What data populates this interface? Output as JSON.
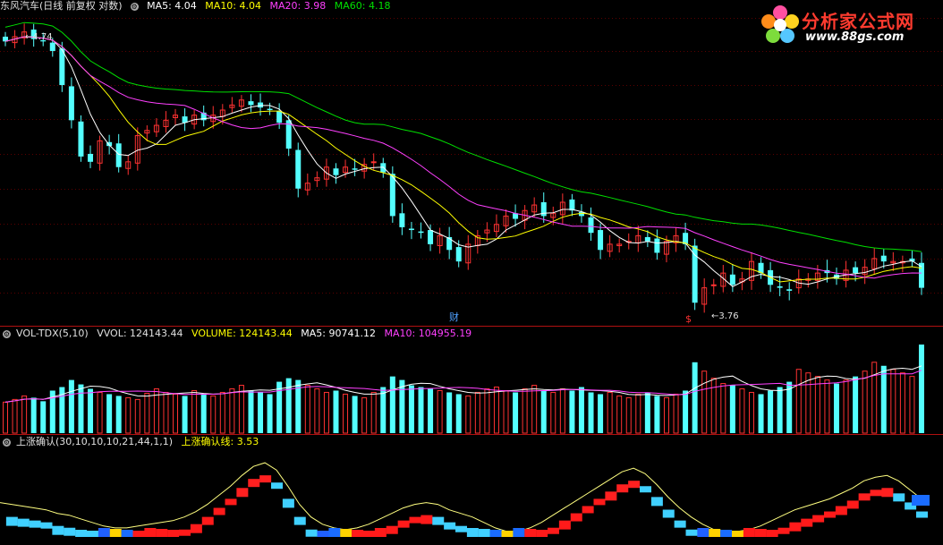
{
  "header": {
    "title": "东风汽车(日线 前复权 对数)",
    "ma5": "MA5: 4.04",
    "ma10": "MA10: 4.04",
    "ma20": "MA20: 3.98",
    "ma60": "MA60: 4.18"
  },
  "logo": {
    "name": "分析家公式网",
    "url": "www.88gs.com"
  },
  "annotations": {
    "high_label": "4.74",
    "low_label": "3.76",
    "cai1": "财",
    "cai2": "$"
  },
  "vol_header": {
    "name": "VOL-TDX(5,10)",
    "vvol": "VVOL: 124143.44",
    "volume": "VOLUME: 124143.44",
    "ma5": "MA5: 90741.12",
    "ma10": "MA10: 104955.19"
  },
  "ind_header": {
    "name": "上涨确认(30,10,10,10,21,44,1,1)",
    "line": "上涨确认线: 3.53"
  },
  "colors": {
    "up": "#ff3232",
    "down": "#54ffff",
    "ma5": "#ffffff",
    "ma10": "#ffff00",
    "ma20": "#ff40ff",
    "ma60": "#00e000"
  },
  "chart_data": [
    {
      "type": "candlestick",
      "title": "东风汽车(日线 前复权 对数)",
      "ylim": [
        3.7,
        4.8
      ],
      "close": [
        4.7,
        4.72,
        4.74,
        4.71,
        4.7,
        4.66,
        4.52,
        4.38,
        4.24,
        4.22,
        4.3,
        4.28,
        4.2,
        4.22,
        4.32,
        4.34,
        4.36,
        4.38,
        4.4,
        4.37,
        4.4,
        4.38,
        4.4,
        4.42,
        4.44,
        4.46,
        4.44,
        4.43,
        4.42,
        4.37,
        4.27,
        4.12,
        4.14,
        4.16,
        4.2,
        4.17,
        4.2,
        4.19,
        4.21,
        4.22,
        4.18,
        4.02,
        3.98,
        3.97,
        3.96,
        3.92,
        3.95,
        3.9,
        3.86,
        3.92,
        3.95,
        3.97,
        3.99,
        4.02,
        4.01,
        4.04,
        4.06,
        4.02,
        4.03,
        4.07,
        4.04,
        4.02,
        3.96,
        3.9,
        3.92,
        3.92,
        3.93,
        3.95,
        3.93,
        3.89,
        3.93,
        3.95,
        3.92,
        3.72,
        3.77,
        3.78,
        3.82,
        3.78,
        3.8,
        3.86,
        3.82,
        3.78,
        3.77,
        3.76,
        3.8,
        3.8,
        3.82,
        3.82,
        3.8,
        3.83,
        3.82,
        3.84,
        3.87,
        3.86,
        3.86,
        3.86,
        3.86,
        3.77
      ]
    },
    {
      "type": "bar",
      "title": "VOL-TDX(5,10)",
      "values": [
        35,
        38,
        42,
        40,
        36,
        48,
        52,
        60,
        55,
        50,
        46,
        44,
        42,
        40,
        38,
        45,
        50,
        46,
        44,
        42,
        48,
        44,
        42,
        46,
        50,
        54,
        48,
        46,
        44,
        58,
        62,
        60,
        54,
        50,
        46,
        48,
        44,
        42,
        40,
        46,
        52,
        64,
        60,
        54,
        52,
        50,
        48,
        46,
        44,
        42,
        46,
        50,
        52,
        48,
        46,
        50,
        54,
        48,
        46,
        50,
        48,
        52,
        46,
        44,
        46,
        42,
        40,
        44,
        46,
        42,
        40,
        44,
        48,
        80,
        70,
        62,
        56,
        54,
        50,
        46,
        44,
        48,
        52,
        58,
        72,
        68,
        64,
        60,
        56,
        60,
        64,
        70,
        80,
        76,
        72,
        68,
        64,
        100
      ],
      "latest": 124143.44
    },
    {
      "type": "line",
      "title": "上涨确认(30,10,10,10,21,44,1,1)",
      "series": [
        {
          "name": "上涨确认线",
          "values": [
            0.42,
            0.4,
            0.38,
            0.36,
            0.34,
            0.3,
            0.28,
            0.24,
            0.2,
            0.16,
            0.14,
            0.14,
            0.16,
            0.18,
            0.2,
            0.22,
            0.26,
            0.32,
            0.4,
            0.5,
            0.6,
            0.72,
            0.82,
            0.86,
            0.78,
            0.6,
            0.4,
            0.26,
            0.18,
            0.14,
            0.12,
            0.14,
            0.18,
            0.24,
            0.3,
            0.36,
            0.4,
            0.42,
            0.4,
            0.34,
            0.3,
            0.26,
            0.2,
            0.14,
            0.1,
            0.1,
            0.14,
            0.2,
            0.28,
            0.36,
            0.44,
            0.52,
            0.6,
            0.68,
            0.76,
            0.8,
            0.74,
            0.62,
            0.48,
            0.36,
            0.26,
            0.18,
            0.12,
            0.1,
            0.1,
            0.12,
            0.16,
            0.22,
            0.28,
            0.34,
            0.38,
            0.42,
            0.46,
            0.52,
            0.58,
            0.66,
            0.7,
            0.72,
            0.66,
            0.56,
            0.46
          ]
        }
      ]
    }
  ]
}
